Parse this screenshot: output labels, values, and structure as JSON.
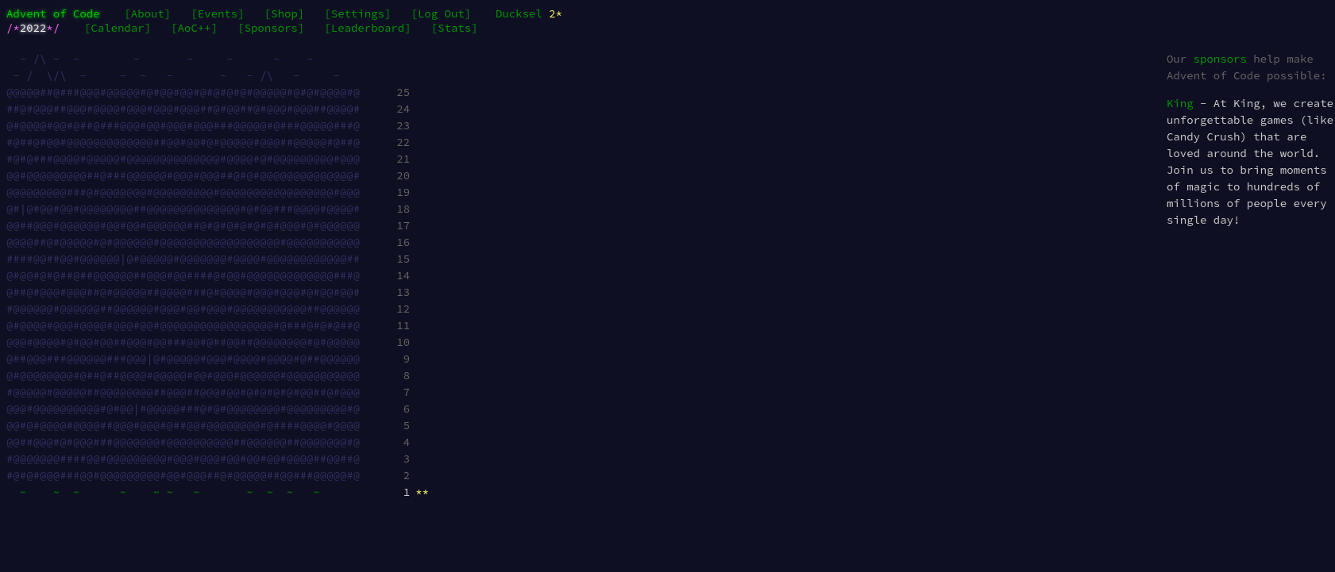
{
  "header": {
    "title_global": "Advent of Code",
    "title_event_prefix": "/*",
    "title_event_year": "2022",
    "title_event_suffix": "*/",
    "nav_global": [
      {
        "label": "[About]"
      },
      {
        "label": "[Events]"
      },
      {
        "label": "[Shop]"
      },
      {
        "label": "[Settings]"
      },
      {
        "label": "[Log Out]"
      }
    ],
    "nav_event": [
      {
        "label": "[Calendar]"
      },
      {
        "label": "[AoC++]"
      },
      {
        "label": "[Sponsors]"
      },
      {
        "label": "[Leaderboard]"
      },
      {
        "label": "[Stats]"
      }
    ],
    "user_name": "Ducksel",
    "user_stars": "2*"
  },
  "calendar": {
    "rows": [
      {
        "art": "  - /\\ -  -        -       -     -      -    -          ",
        "day": "",
        "stars": "",
        "complete": false
      },
      {
        "art": " - /  \\/\\  -     -  -   -       -   - /\\   -     -      ",
        "day": "",
        "stars": "",
        "complete": false
      },
      {
        "art": "@@@@@##@###@@@#@@@@@#@#@@#@@#@#@#@#@#@@@@@#@#@#@@@@#@   ",
        "day": "25",
        "stars": "",
        "complete": false
      },
      {
        "art": "##@#@@@##@@@#@@@@#@@@#@@@#@@@##@#@@##@#@@@#@@@##@@@@#   ",
        "day": "24",
        "stars": "",
        "complete": false
      },
      {
        "art": "@#@@@@#@@#@##@###@@@#@@#@@@#@@@###@@@@@#@###@@@@@###@   ",
        "day": "23",
        "stars": "",
        "complete": false
      },
      {
        "art": "#@##@#@@#@@@@@@@@@@@@@##@@#@@#@#@@@@@#@@@##@@@@@#@##@   ",
        "day": "22",
        "stars": "",
        "complete": false
      },
      {
        "art": "#@#@###@@@@#@@@@@#@@@@@@@@@@@@@@#@@@@#@#@@@@@@@@@#@@@   ",
        "day": "21",
        "stars": "",
        "complete": false
      },
      {
        "art": "@@#@@@@@@@@@##@###@@@@@@#@@@#@@@##@#@#@@@@@@@@@@@@@@#   ",
        "day": "20",
        "stars": "",
        "complete": false
      },
      {
        "art": "@@@@@@@@@###@#@@@@@@@#@@@@@@@@@#@@@@@@@@@@@@@@@@@#@@@   ",
        "day": "19",
        "stars": "",
        "complete": false
      },
      {
        "art": "@#|@#@@#@@#@@@@@@@@##@@@@@@@@@@@@@@#@#@@###@@@@#@@@@#   ",
        "day": "18",
        "stars": "",
        "complete": false
      },
      {
        "art": "@@##@@@#@@@@@@#@@#@@#@@@@@@##@#@#@#@#@#@#@@@#@#@@@@@@   ",
        "day": "17",
        "stars": "",
        "complete": false
      },
      {
        "art": "@@@@##@#@@@@@#@#@@@@@@#@@@@@@@@@@@@@@@@@@#@@@@@@@@@@@   ",
        "day": "16",
        "stars": "",
        "complete": false
      },
      {
        "art": "####@@##@@#@@@@@@|@#@@@@@#@@@@@@@#@@@@#@@@@@@@@@@@@##   ",
        "day": "15",
        "stars": "",
        "complete": false
      },
      {
        "art": "@#@@#@#@##@##@@@@@@##@@@#@@####@#@@#@@@@@@@@@@@@@###@   ",
        "day": "14",
        "stars": "",
        "complete": false
      },
      {
        "art": "@##@#@@@#@@@##@#@@@@@##@@@@###@#@@@@#@@@#@@@#@#@@#@@#   ",
        "day": "13",
        "stars": "",
        "complete": false
      },
      {
        "art": "#@@@@@@#@@@@@@##@@@@@@#@@@#@@#@@@#@@@@@@@@@@@##@@@@@@   ",
        "day": "12",
        "stars": "",
        "complete": false
      },
      {
        "art": "@#@@@@#@@@#@@@@#@@@#@@#@@@@@@@@@@@@@@@@@#@###@#@#@##@   ",
        "day": "11",
        "stars": "",
        "complete": false
      },
      {
        "art": "@@@#@@@@#@#@@#@@##@@@#@@###@@#@##@@##@@@@@@@@#@#@@@@@   ",
        "day": "10",
        "stars": "",
        "complete": false
      },
      {
        "art": "@##@@@###@@@@@@###@@@|@#@@@@@#@@@#@@@@#@@@@#@##@@@@@@   ",
        "day": "9",
        "stars": "",
        "complete": false
      },
      {
        "art": "@#@@@@@@@@#@##@##@@@@#@@@@@#@@#@@@#@@@@@@#@@@@@@@@@@@   ",
        "day": "8",
        "stars": "",
        "complete": false
      },
      {
        "art": "#@@@@@#@@@@@##@@@@@@@@##@@@##@@@#@@#@#@#@#@#@@##@#@@@   ",
        "day": "7",
        "stars": "",
        "complete": false
      },
      {
        "art": "@@@#@@@@@@@@@@#@#@@|#@@@@@###@#@#@@@@@@@@#@@@@@@@@@#@   ",
        "day": "6",
        "stars": "",
        "complete": false
      },
      {
        "art": "@@#@#@@@@#@@@@##@@@#@@@#@##@@#@@@@@@@@#@####@@@@#@@@@   ",
        "day": "5",
        "stars": "",
        "complete": false
      },
      {
        "art": "@@##@@@#@#@@@###@@@@@@@#@@@@@@@@@@##@@@@@@##@@@@@@@#@   ",
        "day": "4",
        "stars": "",
        "complete": false
      },
      {
        "art": "#@@@@@@@####@@#@@@@@@@@@#@@@#@@@#@@#@@#@@#@@@@##@@##@   ",
        "day": "3",
        "stars": "",
        "complete": false
      },
      {
        "art": "#@#@#@@@###@@#@@@@@@@@@#@@#@@@##@#@@@@@##@@###@@@@@#@   ",
        "day": "2",
        "stars": "",
        "complete": false
      },
      {
        "art": "  ~    ~  ~      ~    ~ ~   ~       ~  ~  ~   ~         ",
        "day": "1",
        "stars": "**",
        "complete": true
      }
    ]
  },
  "sidebar": {
    "intro_pre": "Our ",
    "intro_link": "sponsors",
    "intro_post": " help make Advent of Code possible:",
    "sponsor_name": "King",
    "sponsor_desc": " - At King, we create unforgettable games (like Candy Crush) that are loved around the world. Join us to bring moments of magic to hundreds of millions of people every single day!"
  }
}
